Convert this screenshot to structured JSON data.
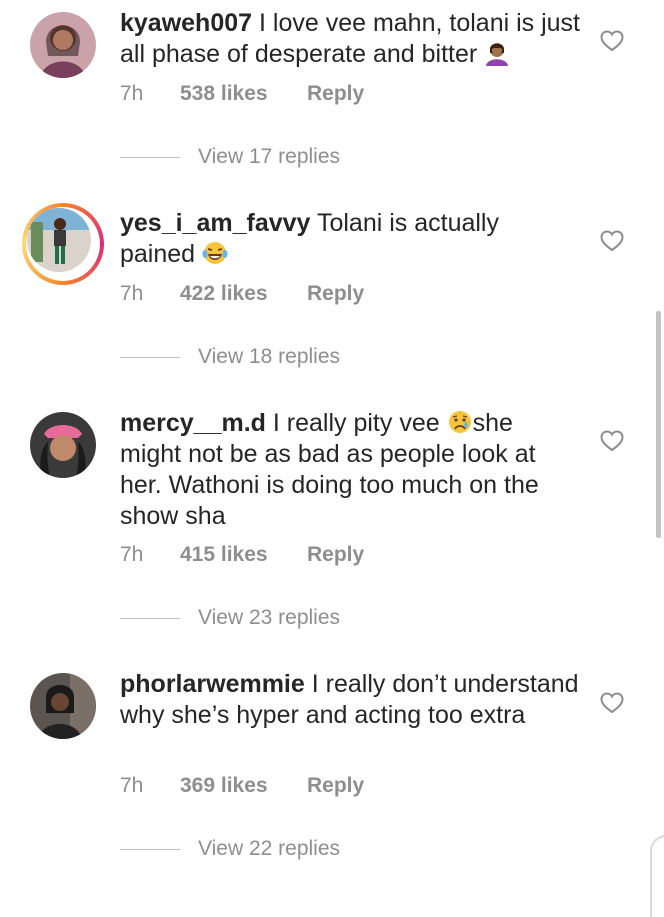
{
  "comments": [
    {
      "username": "kyaweh007",
      "text": "I love vee mahn, tolani is just all phase of desperate and bitter",
      "emoji": "person-facepalming-emoji",
      "time": "7h",
      "likes": "538 likes",
      "reply": "Reply",
      "view_replies": "View 17 replies"
    },
    {
      "username": "yes_i_am_favvy",
      "text": "Tolani is actually pained",
      "emoji": "laughing-tears-emoji",
      "time": "7h",
      "likes": "422 likes",
      "reply": "Reply",
      "view_replies": "View 18 replies"
    },
    {
      "username": "mercy__m.d",
      "text_before": "I really pity vee",
      "emoji": "crying-face-emoji",
      "text_after": "she might not be as bad as people look at her. Wathoni is doing too much on the show sha",
      "time": "7h",
      "likes": "415 likes",
      "reply": "Reply",
      "view_replies": "View 23 replies"
    },
    {
      "username": "phorlarwemmie",
      "text": "I really don’t understand why she’s hyper and acting too extra",
      "time": "7h",
      "likes": "369 likes",
      "reply": "Reply",
      "view_replies": "View 22 replies"
    }
  ],
  "icons": {
    "like": "heart-outline-icon"
  },
  "colors": {
    "text": "#262626",
    "muted": "#8e8e8e",
    "story_ring": "#dd2a7b"
  }
}
